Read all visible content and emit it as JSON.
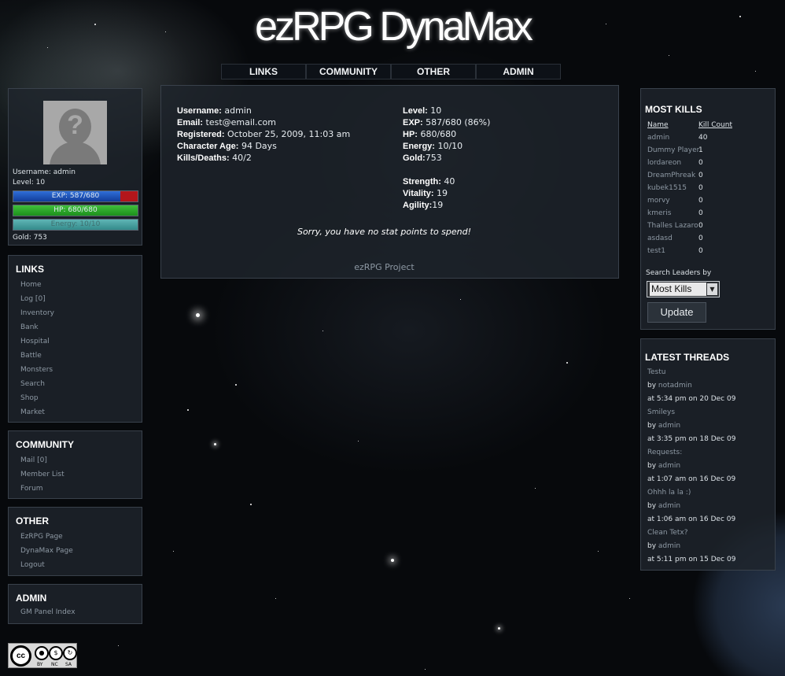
{
  "site": {
    "title": "ezRPG DynaMax"
  },
  "topnav": [
    {
      "label": "LINKS"
    },
    {
      "label": "COMMUNITY"
    },
    {
      "label": "OTHER"
    },
    {
      "label": "ADMIN"
    }
  ],
  "profile": {
    "username_line": "Username: admin",
    "level_line": "Level: 10",
    "exp_text": "EXP: 587/680",
    "exp_fraction": 0.863,
    "hp_text": "HP: 680/680",
    "hp_fraction": 1.0,
    "energy_text": "Energy: 10/10",
    "energy_fraction": 1.0,
    "gold_line": "Gold: 753"
  },
  "links": {
    "title": "LINKS",
    "items": [
      "Home",
      "Log [0]",
      "Inventory",
      "Bank",
      "Hospital",
      "Battle",
      "Monsters",
      "Search",
      "Shop",
      "Market"
    ]
  },
  "community": {
    "title": "COMMUNITY",
    "items": [
      "Mail [0]",
      "Member List",
      "Forum"
    ]
  },
  "other": {
    "title": "OTHER",
    "items": [
      "EzRPG Page",
      "DynaMax Page",
      "Logout"
    ]
  },
  "admin": {
    "title": "ADMIN",
    "items": [
      "GM Panel Index"
    ]
  },
  "main": {
    "left": [
      {
        "label": "Username:",
        "value": " admin"
      },
      {
        "label": "Email:",
        "value": " test@email.com"
      },
      {
        "label": "Registered:",
        "value": " October 25, 2009, 11:03 am"
      },
      {
        "label": "Character Age:",
        "value": " 94 Days"
      },
      {
        "label": "Kills/Deaths:",
        "value": " 40/2"
      }
    ],
    "right_top": [
      {
        "label": "Level:",
        "value": " 10"
      },
      {
        "label": "EXP:",
        "value": " 587/680 (86%)"
      },
      {
        "label": "HP:",
        "value": " 680/680"
      },
      {
        "label": "Energy:",
        "value": " 10/10"
      },
      {
        "label": "Gold:",
        "value": "753"
      }
    ],
    "right_stats": [
      {
        "label": "Strength:",
        "value": " 40"
      },
      {
        "label": "Vitality:",
        "value": " 19"
      },
      {
        "label": "Agility:",
        "value": "19"
      }
    ],
    "no_points": "Sorry, you have no stat points to spend!",
    "footer": "ezRPG Project"
  },
  "most_kills": {
    "title": "MOST KILLS",
    "col_name": "Name",
    "col_count": "Kill Count",
    "rows": [
      {
        "name": "admin",
        "count": "40"
      },
      {
        "name": "Dummy Player",
        "count": "1"
      },
      {
        "name": "lordareon",
        "count": "0"
      },
      {
        "name": "DreamPhreak",
        "count": "0"
      },
      {
        "name": "kubek1515",
        "count": "0"
      },
      {
        "name": "morvy",
        "count": "0"
      },
      {
        "name": "kmeris",
        "count": "0"
      },
      {
        "name": "Thalles Lazaro",
        "count": "0"
      },
      {
        "name": "asdasd",
        "count": "0"
      },
      {
        "name": "test1",
        "count": "0"
      }
    ],
    "search_label": "Search Leaders by",
    "selected": "Most Kills",
    "update_label": "Update"
  },
  "latest_threads": {
    "title": "LATEST THREADS",
    "threads": [
      {
        "title": "Testu",
        "by": "by ",
        "user": "notadmin",
        "when": "at 5:34 pm on 20 Dec 09"
      },
      {
        "title": "Smileys",
        "by": "by ",
        "user": "admin",
        "when": "at 3:35 pm on 18 Dec 09"
      },
      {
        "title": "Requests:",
        "by": "by ",
        "user": "admin",
        "when": "at 1:07 am on 16 Dec 09"
      },
      {
        "title": "Ohhh la la :)",
        "by": "by ",
        "user": "admin",
        "when": "at 1:06 am on 16 Dec 09"
      },
      {
        "title": "Clean Tetx?",
        "by": "by ",
        "user": "admin",
        "when": "at 5:11 pm on 15 Dec 09"
      }
    ]
  },
  "license": {
    "cc": "cc",
    "by": "BY",
    "nc": "NC",
    "sa": "SA",
    "icon": "creative-commons-badge"
  }
}
